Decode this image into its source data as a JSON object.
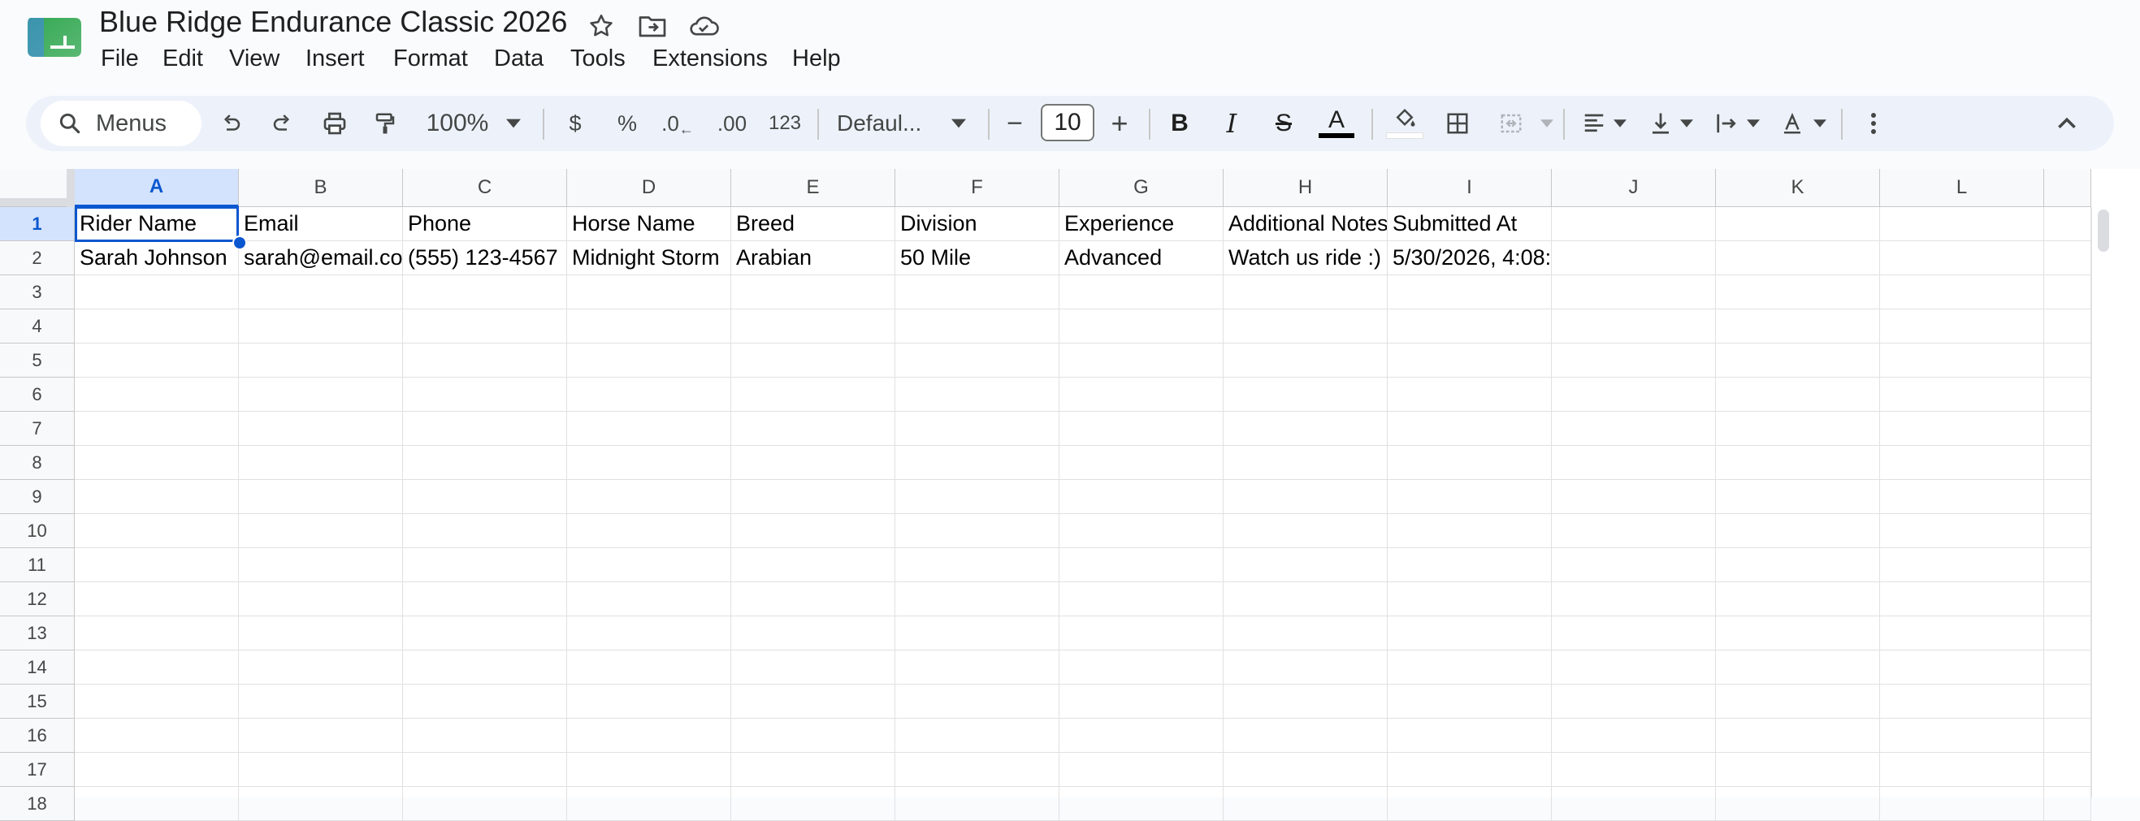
{
  "doc": {
    "title": "Blue Ridge Endurance Classic 2026",
    "logo_icon": "sheets-logo-icon"
  },
  "title_icons": [
    "star-icon",
    "move-folder-icon",
    "cloud-status-icon"
  ],
  "menu": [
    "File",
    "Edit",
    "View",
    "Insert",
    "Format",
    "Data",
    "Tools",
    "Extensions",
    "Help"
  ],
  "toolbar": {
    "search_label": "Menus",
    "zoom": "100%",
    "currency": "$",
    "percent": "%",
    "decrease_decimal": ".0",
    "increase_decimal": ".00",
    "number_format": "123",
    "font": "Defaul...",
    "font_size": "10",
    "minus": "−",
    "plus": "+",
    "bold": "B",
    "italic": "I",
    "strike": "S",
    "text_color": "A",
    "text_color_bar": "#000000"
  },
  "columns": [
    "A",
    "B",
    "C",
    "D",
    "E",
    "F",
    "G",
    "H",
    "I",
    "J",
    "K",
    "L"
  ],
  "rows": [
    "1",
    "2",
    "3",
    "4",
    "5",
    "6",
    "7",
    "8",
    "9",
    "10",
    "11",
    "12",
    "13",
    "14",
    "15",
    "16",
    "17",
    "18"
  ],
  "cells": {
    "r1": [
      "Rider Name",
      "Email",
      "Phone",
      "Horse Name",
      "Breed",
      "Division",
      "Experience",
      "Additional Notes",
      "Submitted At",
      "",
      "",
      ""
    ],
    "r2": [
      "Sarah Johnson",
      "sarah@email.co",
      "(555) 123-4567",
      "Midnight Storm",
      "Arabian",
      "50 Mile",
      "Advanced",
      "Watch us ride :)",
      "5/30/2026, 4:08:",
      "",
      "",
      ""
    ]
  },
  "selected_cell": "A1"
}
